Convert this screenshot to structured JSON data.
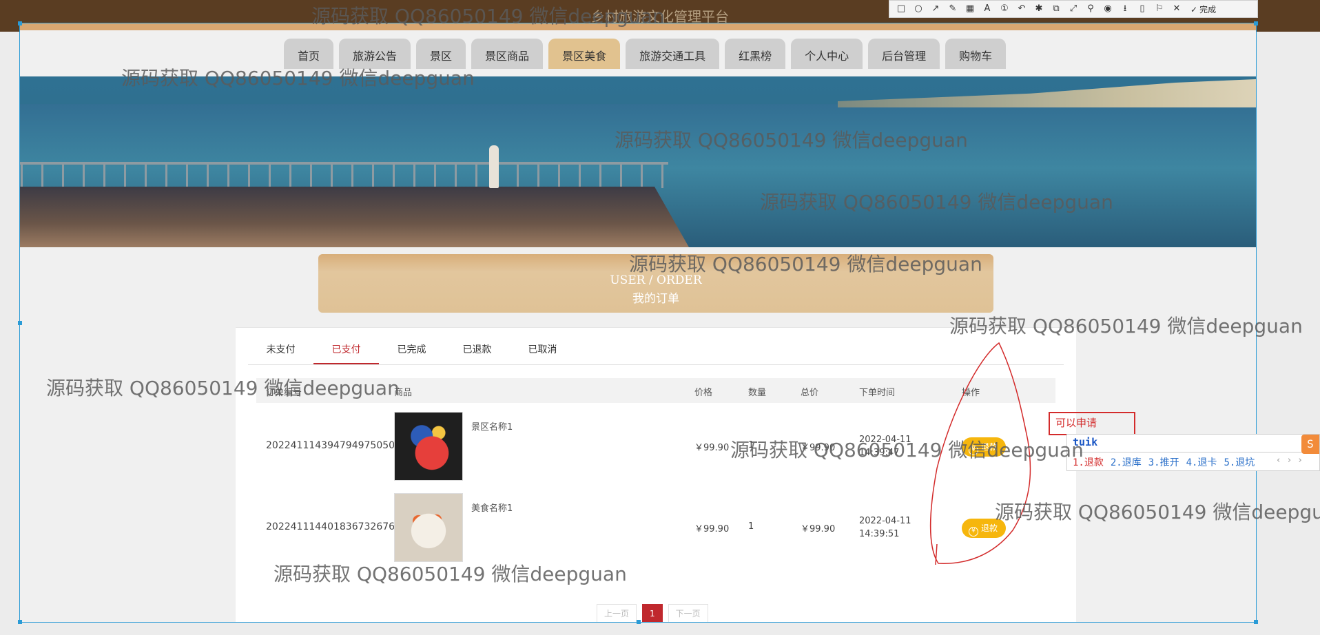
{
  "site_title": "乡村旅游文化管理平台",
  "nav": [
    "首页",
    "旅游公告",
    "景区",
    "景区商品",
    "景区美食",
    "旅游交通工具",
    "红黑榜",
    "个人中心",
    "后台管理",
    "购物车"
  ],
  "nav_active": "景区美食",
  "banner": {
    "en": "USER / ORDER",
    "cn": "我的订单"
  },
  "tabs": [
    "未支付",
    "已支付",
    "已完成",
    "已退款",
    "已取消"
  ],
  "tab_active": "已支付",
  "table_headers": {
    "order_no": "订单编号",
    "product": "商品",
    "price": "价格",
    "qty": "数量",
    "total": "总价",
    "time": "下单时间",
    "action": "操作"
  },
  "orders": [
    {
      "order_no": "2022411143947949750​50",
      "product": "景区名称1",
      "price": "￥99.90",
      "qty": "1",
      "total": "￥99.90",
      "date": "2022-04-11",
      "clock": "14:39:47",
      "action": "退款",
      "thumb": "toy"
    },
    {
      "order_no": "20224111440183673​2676",
      "product": "美食名称1",
      "price": "￥99.90",
      "qty": "1",
      "total": "￥99.90",
      "date": "2022-04-11",
      "clock": "14:39:51",
      "action": "退款",
      "thumb": "food"
    }
  ],
  "pager": {
    "prev": "上一页",
    "current": "1",
    "next": "下一页"
  },
  "annotation": {
    "hint_text": "可以申请"
  },
  "ime": {
    "input": "tuik",
    "candidates": [
      "1.退款",
      "2.退库",
      "3.推开",
      "4.退卡",
      "5.退坑"
    ],
    "arrows": "‹ › ›"
  },
  "toolbar": {
    "tools": [
      {
        "name": "rect-tool-icon",
        "glyph": "□"
      },
      {
        "name": "ellipse-tool-icon",
        "glyph": "○"
      },
      {
        "name": "arrow-tool-icon",
        "glyph": "↗"
      },
      {
        "name": "pen-tool-icon",
        "glyph": "✎"
      },
      {
        "name": "mosaic-tool-icon",
        "glyph": "▦"
      },
      {
        "name": "text-tool-icon",
        "glyph": "A"
      },
      {
        "name": "number-tool-icon",
        "glyph": "①"
      },
      {
        "name": "undo-icon",
        "glyph": "↶"
      },
      {
        "name": "effect-tool-icon",
        "glyph": "✱"
      },
      {
        "name": "ocr-tool-icon",
        "glyph": "⧉"
      },
      {
        "name": "scroll-capture-icon",
        "glyph": "⤢"
      },
      {
        "name": "pin-icon",
        "glyph": "⚲"
      },
      {
        "name": "record-icon",
        "glyph": "◉"
      },
      {
        "name": "download-icon",
        "glyph": "⭳"
      },
      {
        "name": "phone-icon",
        "glyph": "▯"
      },
      {
        "name": "bookmark-icon",
        "glyph": "⚐"
      },
      {
        "name": "close-icon",
        "glyph": "✕"
      }
    ],
    "done_label": "完成"
  },
  "watermark": "源码获取 QQ86050149 微信deepguan"
}
